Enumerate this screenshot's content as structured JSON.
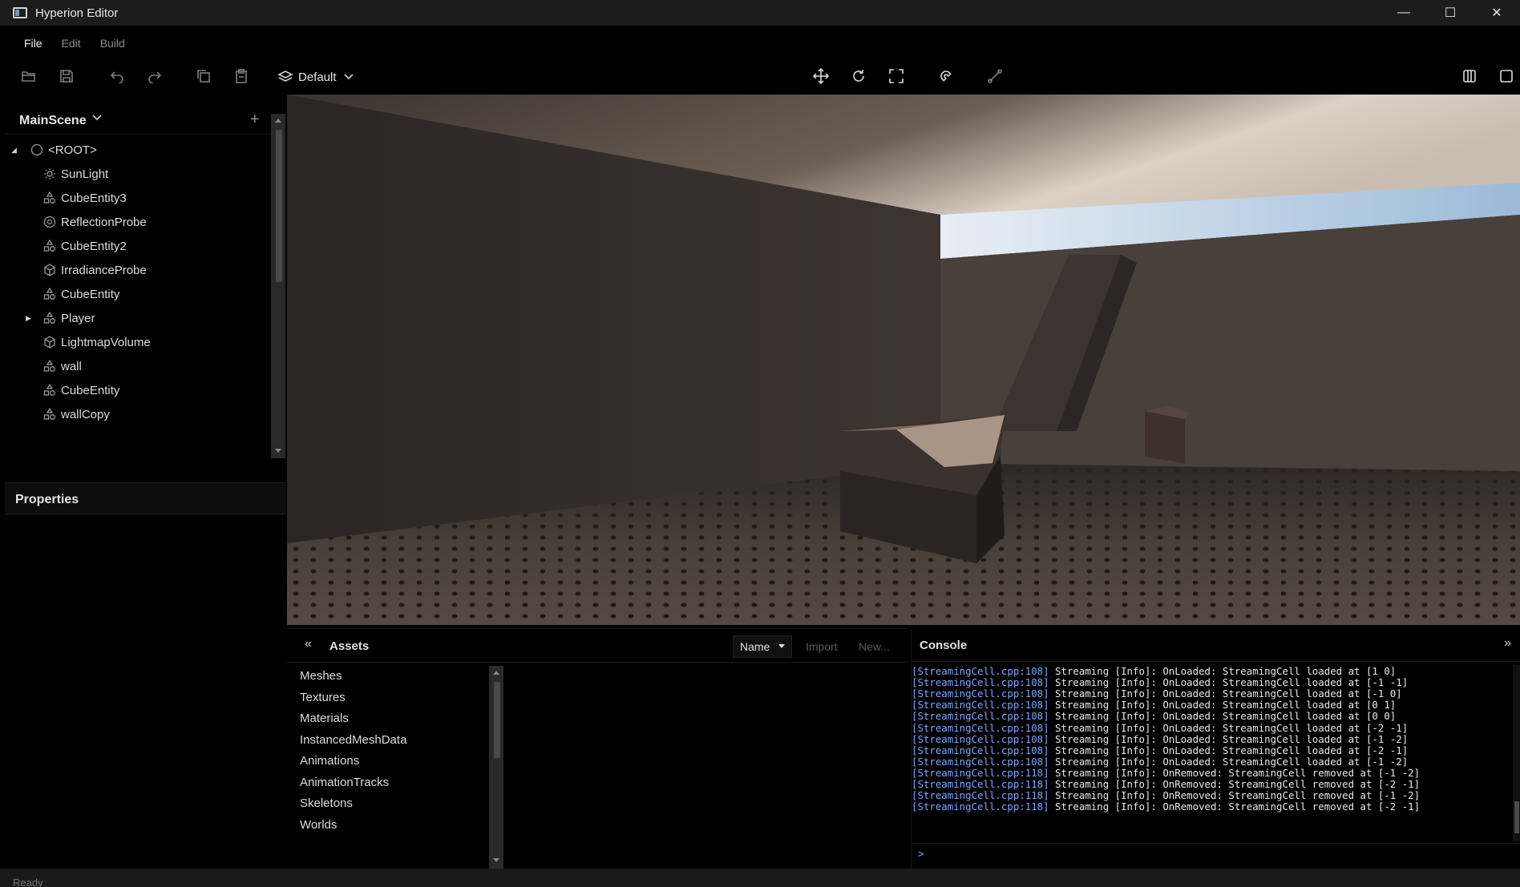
{
  "window": {
    "title": "Hyperion Editor",
    "minimize": "—",
    "maximize": "☐",
    "close": "✕"
  },
  "menu": {
    "items": [
      "File",
      "Edit",
      "Build"
    ]
  },
  "toolbar": {
    "layer_label": "Default"
  },
  "scene": {
    "title": "MainScene",
    "add": "+",
    "tree": [
      {
        "label": "<ROOT>",
        "icon": "circle-icon",
        "depth": 0,
        "expand": "expanded"
      },
      {
        "label": "SunLight",
        "icon": "sun-icon",
        "depth": 1
      },
      {
        "label": "CubeEntity3",
        "icon": "shapes-icon",
        "depth": 1
      },
      {
        "label": "ReflectionProbe",
        "icon": "reflection-probe-icon",
        "depth": 1
      },
      {
        "label": "CubeEntity2",
        "icon": "shapes-icon",
        "depth": 1
      },
      {
        "label": "IrradianceProbe",
        "icon": "cube-icon",
        "depth": 1
      },
      {
        "label": "CubeEntity",
        "icon": "shapes-icon",
        "depth": 1
      },
      {
        "label": "Player",
        "icon": "shapes-icon",
        "depth": 1,
        "expand": "collapsed"
      },
      {
        "label": "LightmapVolume",
        "icon": "cube-icon",
        "depth": 1
      },
      {
        "label": "wall",
        "icon": "shapes-icon",
        "depth": 1
      },
      {
        "label": "CubeEntity",
        "icon": "shapes-icon",
        "depth": 1
      },
      {
        "label": "wallCopy",
        "icon": "shapes-icon",
        "depth": 1
      }
    ]
  },
  "properties": {
    "title": "Properties"
  },
  "assets": {
    "title": "Assets",
    "sort": "Name",
    "import": "Import",
    "new": "New...",
    "categories": [
      "Meshes",
      "Textures",
      "Materials",
      "InstancedMeshData",
      "Animations",
      "AnimationTracks",
      "Skeletons",
      "Worlds"
    ]
  },
  "console": {
    "title": "Console",
    "prompt": ">",
    "lines": [
      {
        "src": "[StreamingCell.cpp:108]",
        "msg": " Streaming [Info]: OnLoaded: StreamingCell loaded at [1 0]"
      },
      {
        "src": "[StreamingCell.cpp:108]",
        "msg": " Streaming [Info]: OnLoaded: StreamingCell loaded at [-1 -1]"
      },
      {
        "src": "[StreamingCell.cpp:108]",
        "msg": " Streaming [Info]: OnLoaded: StreamingCell loaded at [-1 0]"
      },
      {
        "src": "[StreamingCell.cpp:108]",
        "msg": " Streaming [Info]: OnLoaded: StreamingCell loaded at [0 1]"
      },
      {
        "src": "[StreamingCell.cpp:108]",
        "msg": " Streaming [Info]: OnLoaded: StreamingCell loaded at [0 0]"
      },
      {
        "src": "[StreamingCell.cpp:108]",
        "msg": " Streaming [Info]: OnLoaded: StreamingCell loaded at [-2 -1]"
      },
      {
        "src": "[StreamingCell.cpp:108]",
        "msg": " Streaming [Info]: OnLoaded: StreamingCell loaded at [-1 -2]"
      },
      {
        "src": "[StreamingCell.cpp:108]",
        "msg": " Streaming [Info]: OnLoaded: StreamingCell loaded at [-2 -1]"
      },
      {
        "src": "[StreamingCell.cpp:108]",
        "msg": " Streaming [Info]: OnLoaded: StreamingCell loaded at [-1 -2]"
      },
      {
        "src": "[StreamingCell.cpp:118]",
        "msg": " Streaming [Info]: OnRemoved: StreamingCell removed at [-1 -2]"
      },
      {
        "src": "[StreamingCell.cpp:118]",
        "msg": " Streaming [Info]: OnRemoved: StreamingCell removed at [-2 -1]"
      },
      {
        "src": "[StreamingCell.cpp:118]",
        "msg": " Streaming [Info]: OnRemoved: StreamingCell removed at [-1 -2]"
      },
      {
        "src": "[StreamingCell.cpp:118]",
        "msg": " Streaming [Info]: OnRemoved: StreamingCell removed at [-2 -1]"
      }
    ]
  },
  "status": {
    "text": "Ready"
  },
  "colors": {
    "log_source": "#7ea6ff",
    "background": "#000000",
    "titlebar": "#1c1c1c"
  }
}
